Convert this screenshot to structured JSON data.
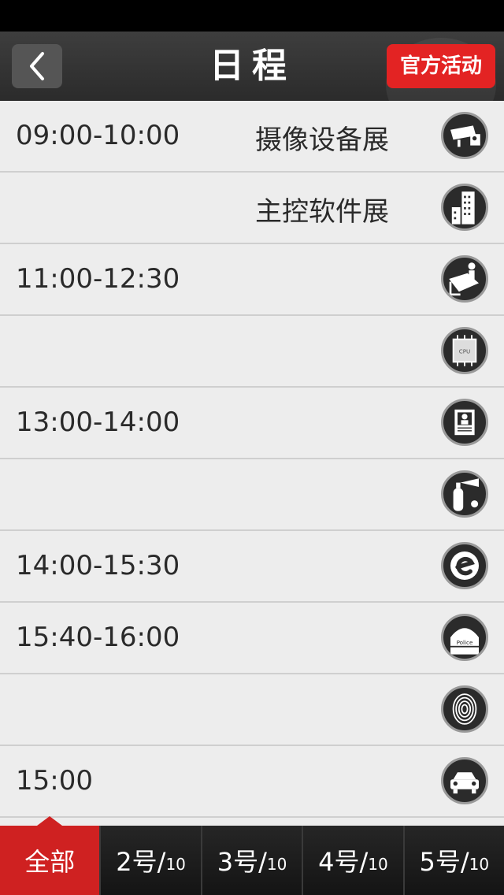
{
  "header": {
    "title": "日程",
    "official_label": "官方活动"
  },
  "schedule": [
    {
      "time": "09:00-10:00",
      "event": "摄像设备展",
      "icon": "security-camera-icon"
    },
    {
      "time": "",
      "event": "主控软件展",
      "icon": "buildings-icon"
    },
    {
      "time": "11:00-12:30",
      "event": "",
      "icon": "presenter-desk-icon"
    },
    {
      "time": "",
      "event": "",
      "icon": "cpu-chip-icon",
      "icon_text": "CPU"
    },
    {
      "time": "13:00-14:00",
      "event": "",
      "icon": "id-badge-icon"
    },
    {
      "time": "",
      "event": "",
      "icon": "fire-extinguisher-icon"
    },
    {
      "time": "14:00-15:30",
      "event": "",
      "icon": "e-logo-icon"
    },
    {
      "time": "15:40-16:00",
      "event": "",
      "icon": "police-cap-icon",
      "icon_text": "Police"
    },
    {
      "time": "",
      "event": "",
      "icon": "fingerprint-icon"
    },
    {
      "time": "15:00",
      "event": "",
      "icon": "car-icon"
    }
  ],
  "tabs": [
    {
      "day": "全部",
      "total": ""
    },
    {
      "day": "2号/",
      "total": "10"
    },
    {
      "day": "3号/",
      "total": "10"
    },
    {
      "day": "4号/",
      "total": "10"
    },
    {
      "day": "5号/",
      "total": "10"
    }
  ],
  "colors": {
    "accent": "#e32323",
    "navbar": "#333333",
    "row_bg": "#ededed",
    "icon_bg": "#2b2b2b"
  }
}
